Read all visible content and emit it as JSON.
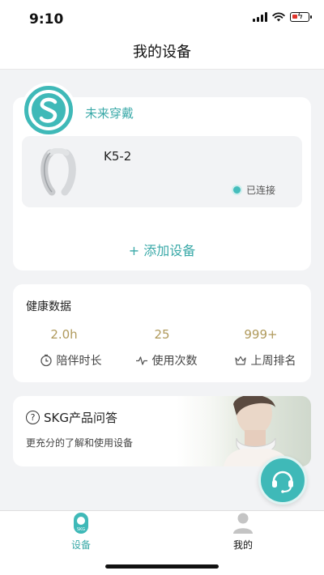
{
  "status_bar": {
    "time": "9:10"
  },
  "nav": {
    "title": "我的设备"
  },
  "device_card": {
    "brand_name": "未来穿戴",
    "device": {
      "name": "K5-2",
      "status": "已连接"
    },
    "add_device_label": "+ 添加设备"
  },
  "health": {
    "title": "健康数据",
    "stats": [
      {
        "value": "2.0h",
        "label": "陪伴时长",
        "icon": "clock-icon"
      },
      {
        "value": "25",
        "label": "使用次数",
        "icon": "pulse-icon"
      },
      {
        "value": "999+",
        "label": "上周排名",
        "icon": "crown-icon"
      }
    ]
  },
  "qa": {
    "title": "SKG产品问答",
    "subtitle": "更充分的了解和使用设备"
  },
  "tabs": [
    {
      "label": "设备",
      "icon": "device-icon",
      "active": true
    },
    {
      "label": "我的",
      "icon": "person-icon",
      "active": false
    }
  ],
  "colors": {
    "accent": "#3fb9b8",
    "stat_gold": "#b09a5c",
    "background": "#f2f3f5"
  }
}
